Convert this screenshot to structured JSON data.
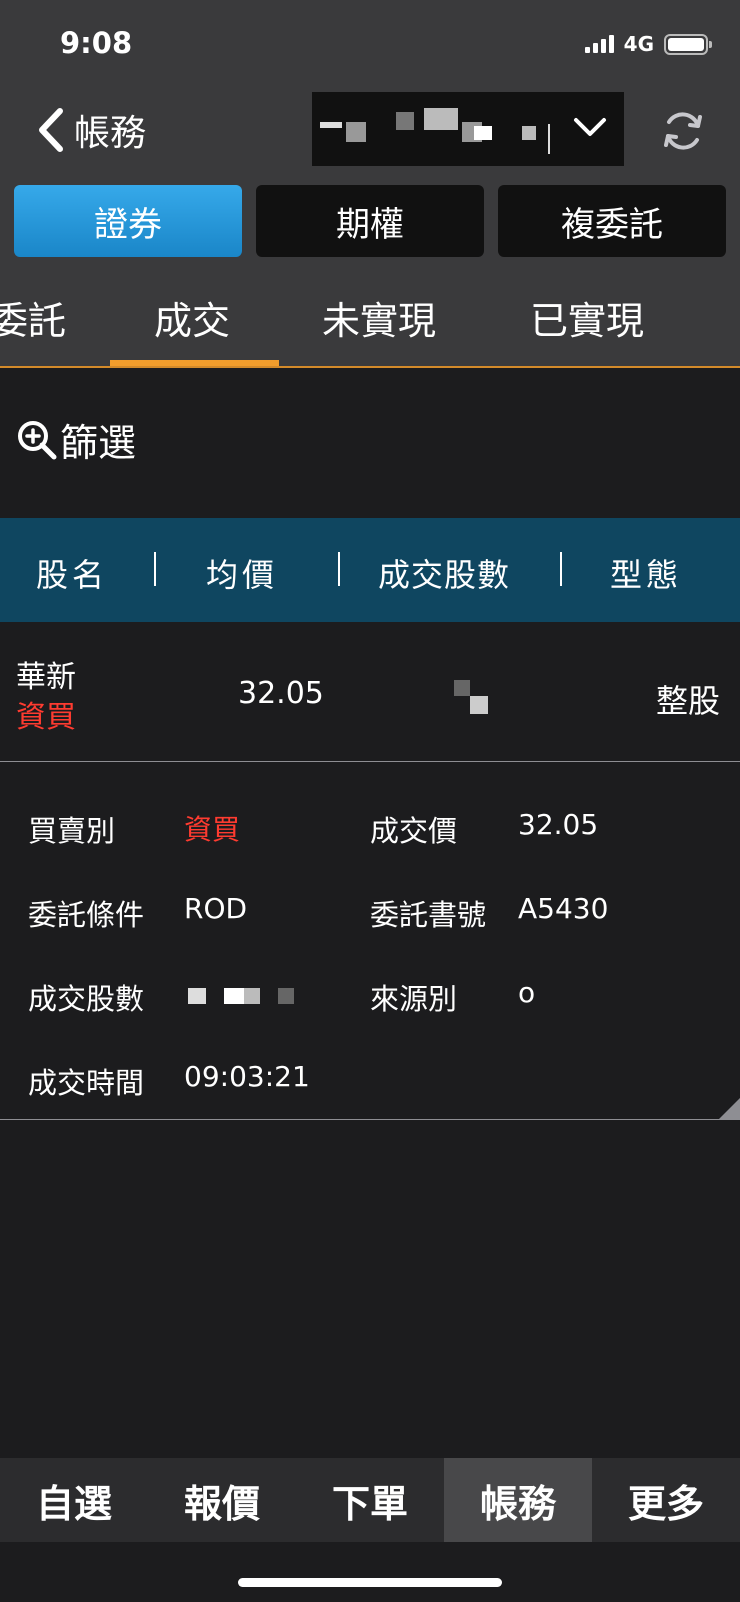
{
  "status_bar": {
    "time": "9:08",
    "network": "4G"
  },
  "nav": {
    "back_label": "帳務"
  },
  "segments": [
    {
      "label": "證券",
      "active": true
    },
    {
      "label": "期權",
      "active": false
    },
    {
      "label": "複委託",
      "active": false
    }
  ],
  "tabs": [
    {
      "label": "委託"
    },
    {
      "label": "成交",
      "active": true
    },
    {
      "label": "未實現"
    },
    {
      "label": "已實現"
    }
  ],
  "filter": {
    "label": "篩選"
  },
  "table": {
    "headers": [
      "股名",
      "均價",
      "成交股數",
      "型態"
    ],
    "rows": [
      {
        "name": "華新",
        "type": "資買",
        "avg_price": "32.05",
        "status": "整股"
      }
    ]
  },
  "detail": {
    "fields": [
      {
        "label": "買賣別",
        "value": "資買"
      },
      {
        "label": "成交價",
        "value": "32.05"
      },
      {
        "label": "委託條件",
        "value": "ROD"
      },
      {
        "label": "委託書號",
        "value": "A5430"
      },
      {
        "label": "成交股數",
        "value": ""
      },
      {
        "label": "來源別",
        "value": "o"
      },
      {
        "label": "成交時間",
        "value": "09:03:21"
      }
    ]
  },
  "bottom_nav": [
    {
      "label": "自選"
    },
    {
      "label": "報價"
    },
    {
      "label": "下單"
    },
    {
      "label": "帳務",
      "active": true
    },
    {
      "label": "更多"
    }
  ],
  "colors": {
    "accent_tab": "#f29d2c",
    "segment_active": "#1a86c8",
    "header_bg": "#0f4660",
    "buy_red": "#ff3b30"
  },
  "icons": [
    "back-chevron-icon",
    "chevron-down-icon",
    "refresh-icon",
    "zoom-in-icon"
  ]
}
